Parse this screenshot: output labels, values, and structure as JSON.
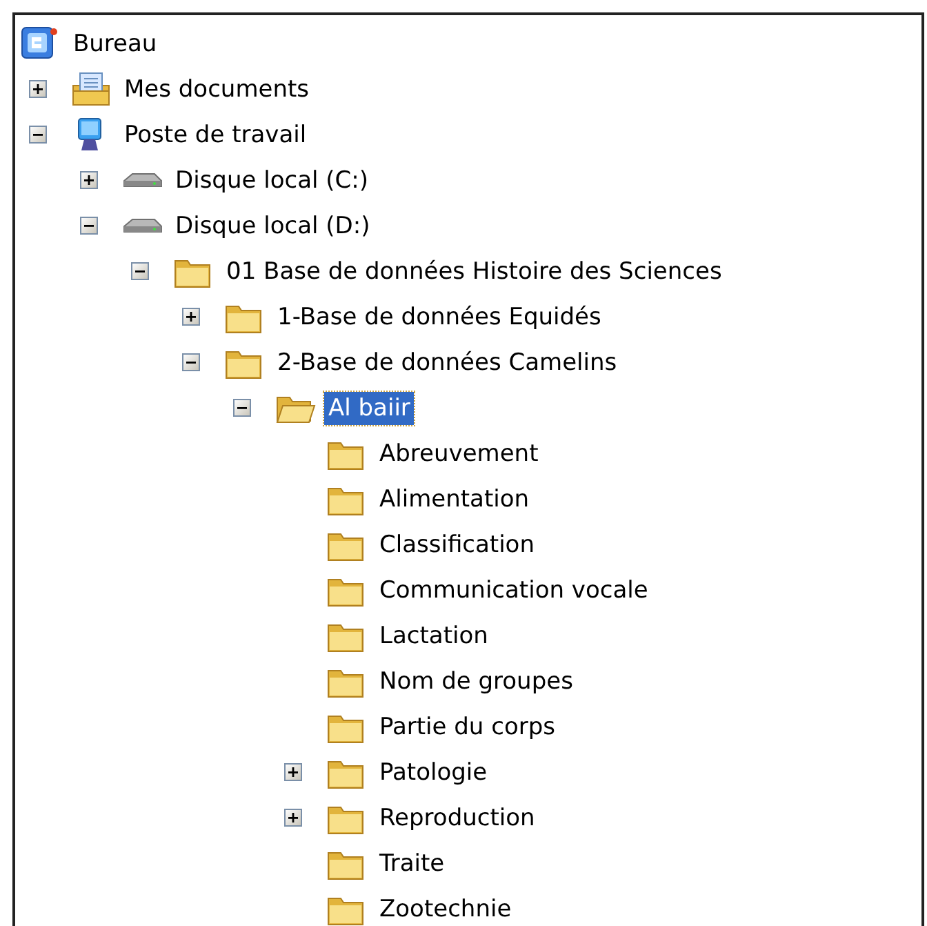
{
  "tree": {
    "label": "Bureau",
    "kind": "desktop",
    "selected": false,
    "children": [
      {
        "label": "Mes documents",
        "kind": "documents",
        "expanded": false,
        "selected": false
      },
      {
        "label": "Poste de travail",
        "kind": "computer",
        "expanded": true,
        "selected": false,
        "children": [
          {
            "label": "Disque local (C:)",
            "kind": "drive",
            "expanded": false,
            "selected": false
          },
          {
            "label": "Disque local (D:)",
            "kind": "drive",
            "expanded": true,
            "selected": false,
            "children": [
              {
                "label": "01 Base de données Histoire des Sciences",
                "kind": "folder",
                "expanded": true,
                "selected": false,
                "children": [
                  {
                    "label": "1-Base de données Equidés",
                    "kind": "folder",
                    "expanded": false,
                    "selected": false
                  },
                  {
                    "label": "2-Base de données Camelins",
                    "kind": "folder",
                    "expanded": true,
                    "selected": false,
                    "children": [
                      {
                        "label": "Al baiir",
                        "kind": "folder-open",
                        "expanded": true,
                        "selected": true,
                        "children": [
                          {
                            "label": "Abreuvement",
                            "kind": "folder",
                            "selected": false
                          },
                          {
                            "label": "Alimentation",
                            "kind": "folder",
                            "selected": false
                          },
                          {
                            "label": "Classification",
                            "kind": "folder",
                            "selected": false
                          },
                          {
                            "label": "Communication vocale",
                            "kind": "folder",
                            "selected": false
                          },
                          {
                            "label": "Lactation",
                            "kind": "folder",
                            "selected": false
                          },
                          {
                            "label": "Nom de groupes",
                            "kind": "folder",
                            "selected": false
                          },
                          {
                            "label": "Partie du corps",
                            "kind": "folder",
                            "selected": false
                          },
                          {
                            "label": "Patologie",
                            "kind": "folder",
                            "expanded": false,
                            "selected": false
                          },
                          {
                            "label": "Reproduction",
                            "kind": "folder",
                            "expanded": false,
                            "selected": false
                          },
                          {
                            "label": "Traite",
                            "kind": "folder",
                            "selected": false
                          },
                          {
                            "label": "Zootechnie",
                            "kind": "folder",
                            "selected": false
                          }
                        ]
                      }
                    ]
                  }
                ]
              }
            ]
          }
        ]
      }
    ]
  }
}
